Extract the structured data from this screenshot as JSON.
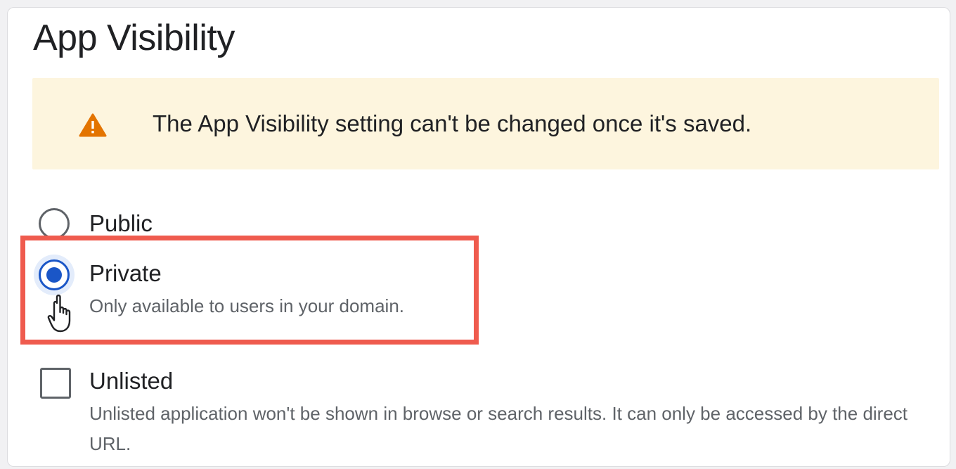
{
  "section": {
    "title": "App Visibility"
  },
  "banner": {
    "icon": "warning-icon",
    "icon_color": "#e37400",
    "background": "#fdf5de",
    "message": "The App Visibility setting can't be changed once it's saved."
  },
  "visibility_options": {
    "selected": "Private",
    "public": {
      "label": "Public",
      "checked": false
    },
    "private": {
      "label": "Private",
      "description": "Only available to users in your domain.",
      "checked": true
    }
  },
  "unlisted": {
    "label": "Unlisted",
    "checked": false,
    "description": "Unlisted application won't be shown in browse or search results. It can only be accessed by the direct URL."
  },
  "colors": {
    "accent": "#1a56c7",
    "highlight_border": "#ef5b4e"
  },
  "cursor": {
    "icon": "hand-pointer-icon"
  }
}
